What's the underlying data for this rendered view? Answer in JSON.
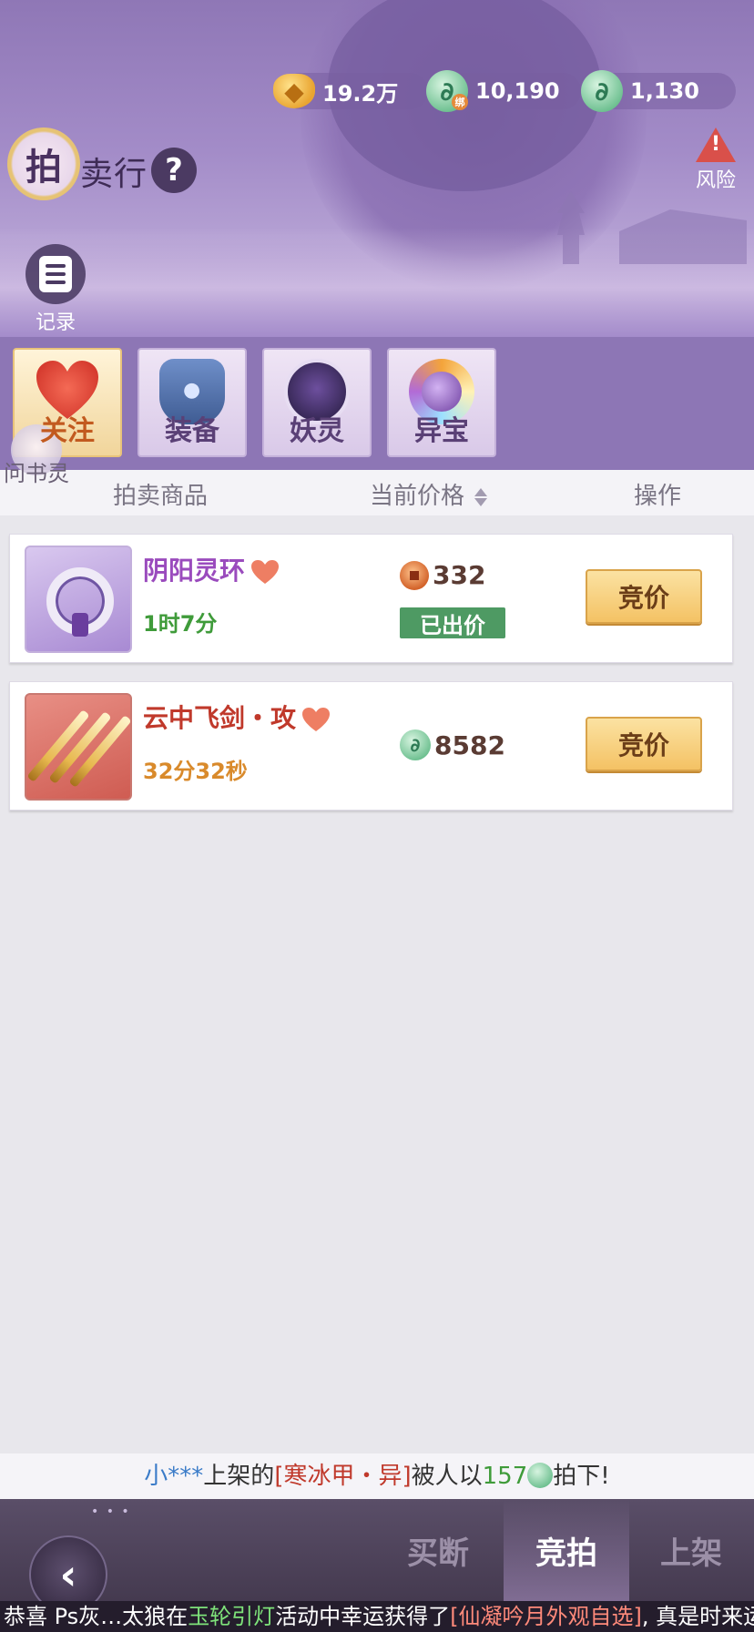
{
  "currency": {
    "gold": "19.2万",
    "bound_jade": "10,190",
    "bound_tag": "绑",
    "jade": "1,130"
  },
  "header": {
    "title_badge": "拍",
    "title_text": "卖行",
    "help": "?",
    "risk_label": "风险",
    "record_label": "记录"
  },
  "categories": [
    {
      "label": "关注",
      "icon": "heart-icon",
      "active": true
    },
    {
      "label": "装备",
      "icon": "armor-icon",
      "active": false
    },
    {
      "label": "妖灵",
      "icon": "spirit-icon",
      "active": false
    },
    {
      "label": "异宝",
      "icon": "treasure-icon",
      "active": false
    }
  ],
  "mascot_label": "问书灵",
  "list_header": {
    "item": "拍卖商品",
    "price": "当前价格",
    "action": "操作"
  },
  "items": [
    {
      "name": "阴阳灵环",
      "time_left": "1时7分",
      "price": "332",
      "currency_icon": "copper-coin-icon",
      "status": "已出价",
      "action": "竞价"
    },
    {
      "name": "云中飞剑・攻",
      "time_left": "32分32秒",
      "price": "8582",
      "currency_icon": "jade-icon",
      "action": "竞价"
    }
  ],
  "notice": {
    "user": "小***",
    "text1": "上架的",
    "item": "[寒冰甲・异]",
    "text2": "被人以",
    "amount": "157",
    "text3": "拍下!"
  },
  "bottom_tabs": {
    "buyout": "买断",
    "auction": "竞拍",
    "list": "上架"
  },
  "marquee": {
    "part1": "恭喜 Ps灰…太狼在",
    "part2": "玉轮引灯",
    "part3": "活动中幸运获得了",
    "part4": "[仙凝吟月外观自选]",
    "part5": ", 真是时来运转!"
  },
  "colors": {
    "accent_purple": "#8d76b5",
    "bid_button": "#f4c264",
    "status_green": "#4e9a63"
  }
}
